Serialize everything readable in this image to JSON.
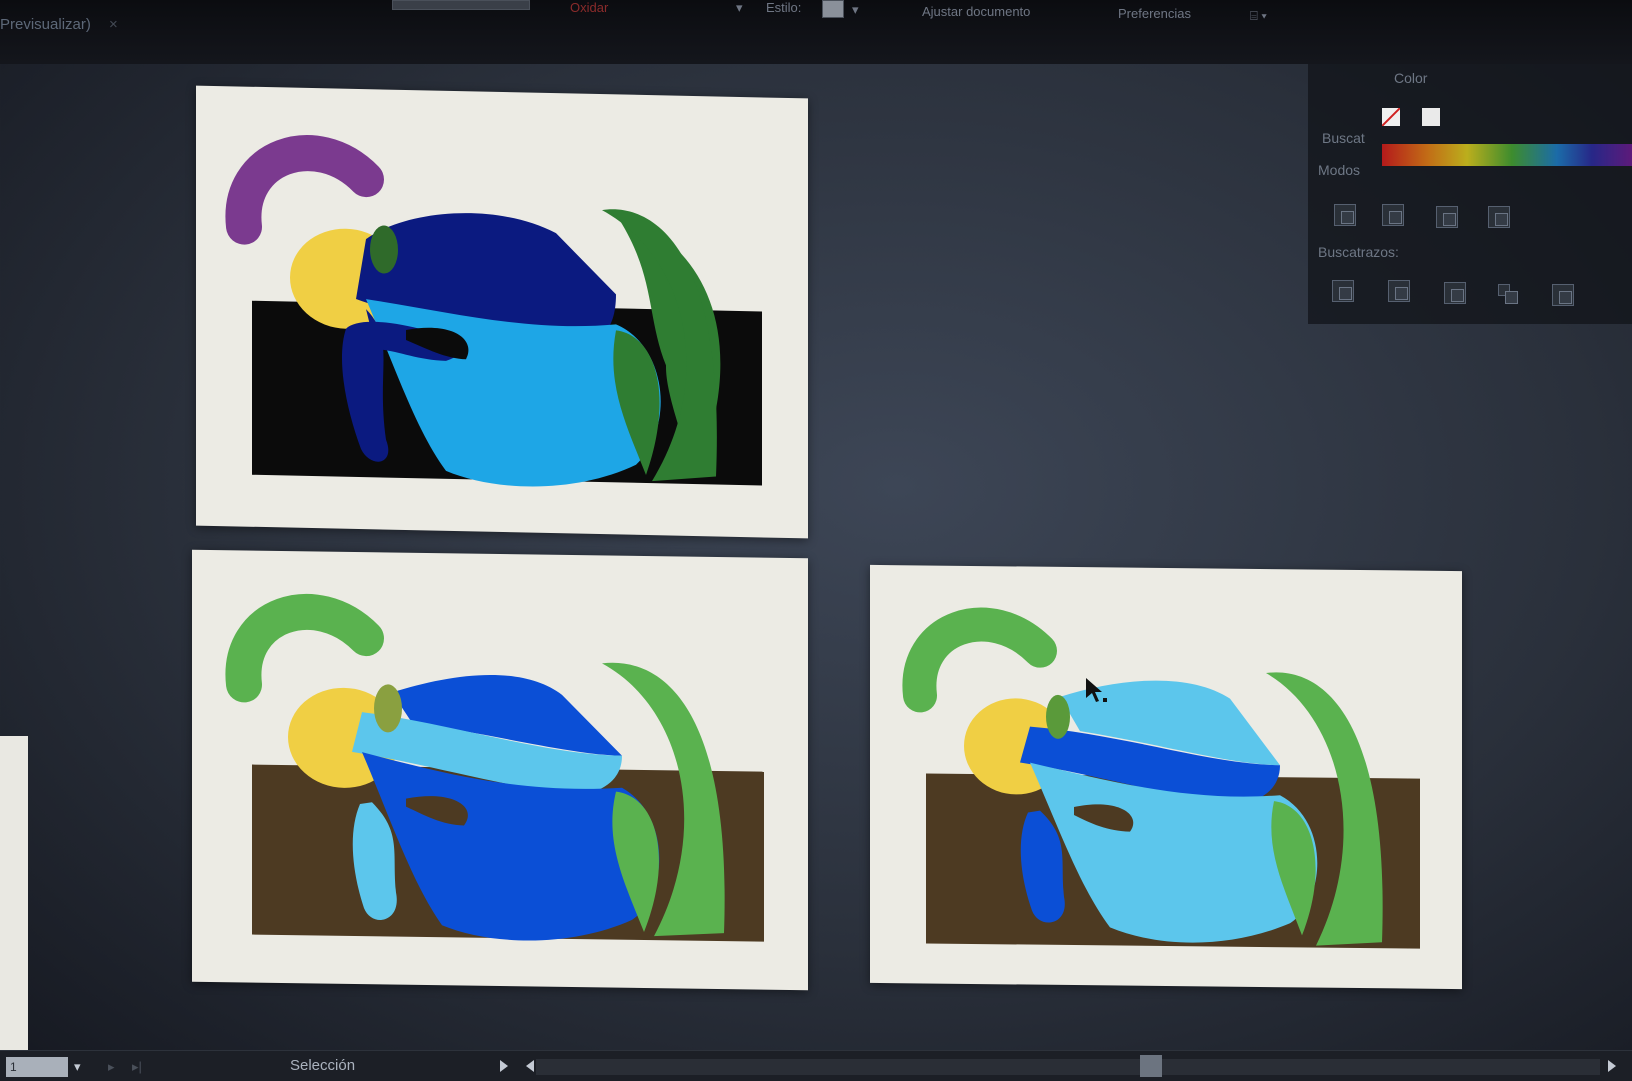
{
  "toolbar": {
    "document_tab": "Previsualizar)",
    "document_tab_close": "×",
    "red_label": "Oxidar",
    "style_label": "Estilo:",
    "adjust_document": "Ajustar documento",
    "preferences": "Preferencias"
  },
  "color_panel": {
    "title": "Color",
    "label_buscat": "Buscat",
    "label_modos": "Modos",
    "pathfinder_label": "Buscatrazos:"
  },
  "status": {
    "zoom_value": "1",
    "tool": "Selección"
  },
  "colors": {
    "purple": "#7b3a8f",
    "yellow": "#f0cf44",
    "dark_navy": "#0b1a80",
    "sky_blue": "#1ea6e6",
    "dark_green": "#2f7d32",
    "black": "#0b0b0b",
    "light_green": "#5ab24f",
    "royal_blue": "#0b4fd6",
    "pale_blue": "#5cc6ec",
    "brown": "#4d3a22",
    "paper": "#ecebe4"
  }
}
